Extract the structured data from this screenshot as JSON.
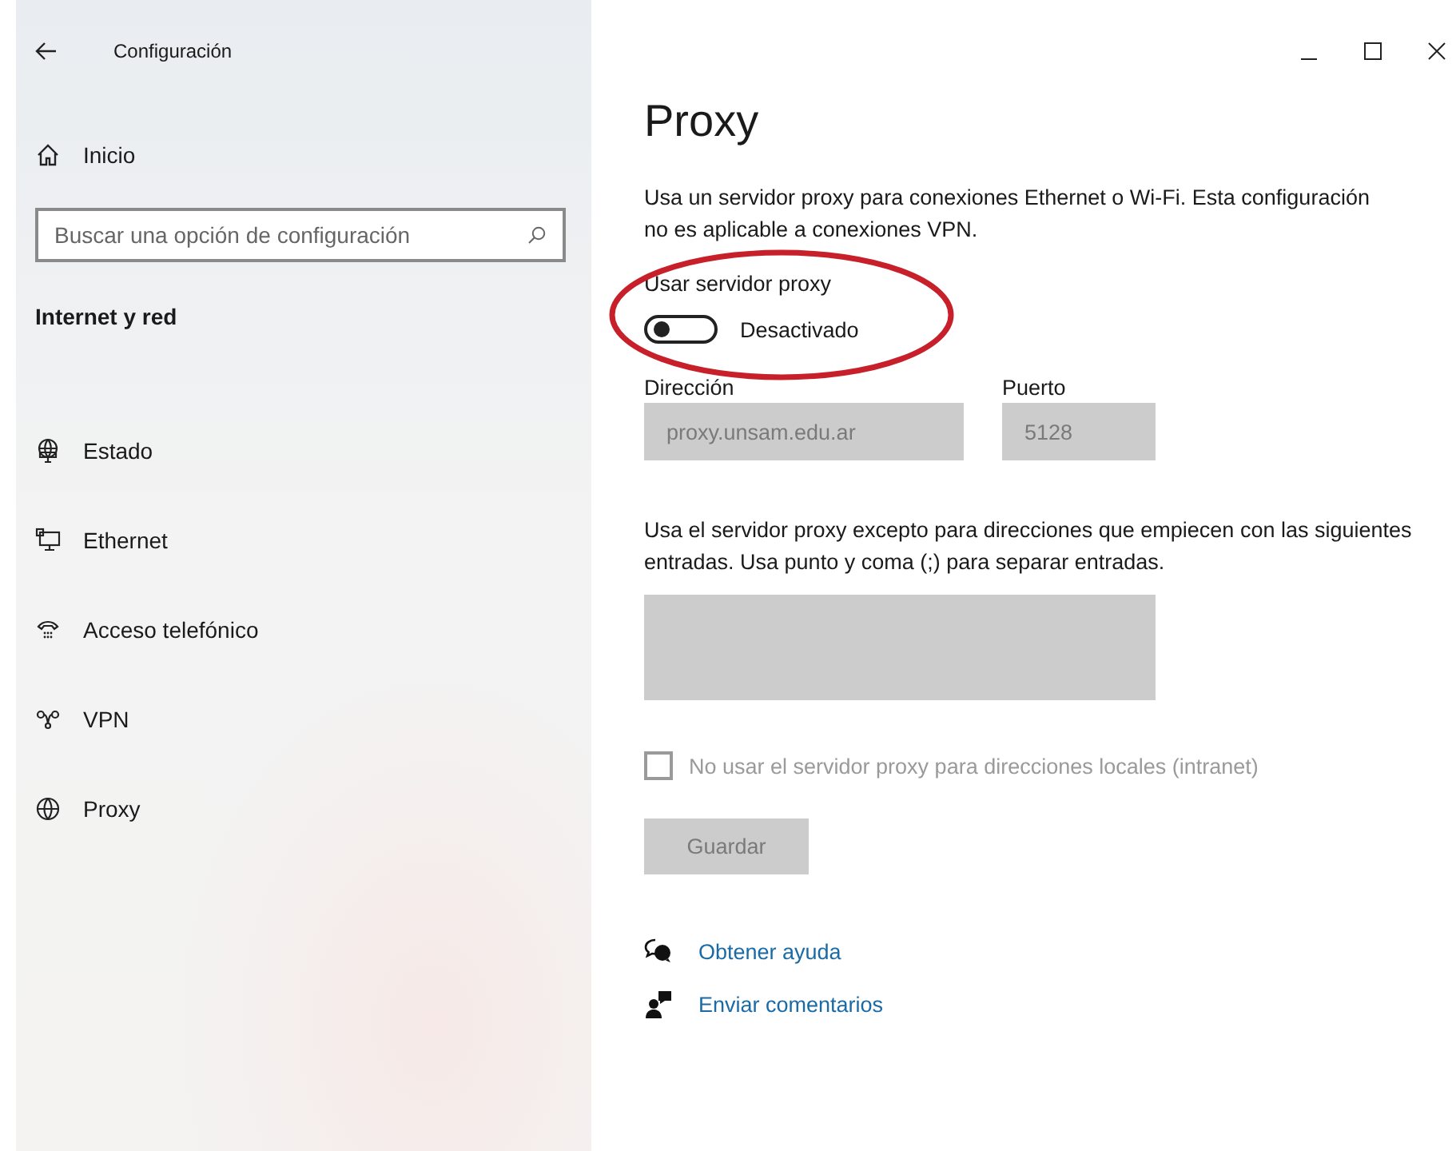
{
  "window": {
    "title": "Configuración"
  },
  "sidebar": {
    "home": {
      "label": "Inicio"
    },
    "search": {
      "placeholder": "Buscar una opción de configuración"
    },
    "heading": "Internet y red",
    "items": [
      {
        "kind": "status",
        "label": "Estado"
      },
      {
        "kind": "ethernet",
        "label": "Ethernet"
      },
      {
        "kind": "dialup",
        "label": "Acceso telefónico"
      },
      {
        "kind": "vpn",
        "label": "VPN"
      },
      {
        "kind": "proxy",
        "label": "Proxy"
      }
    ]
  },
  "content": {
    "title": "Proxy",
    "description": "Usa un servidor proxy para conexiones Ethernet o Wi-Fi. Esta configuración no es aplicable a conexiones VPN.",
    "proxy_toggle": {
      "label": "Usar servidor proxy",
      "on": false,
      "state_text": "Desactivado",
      "circled": true
    },
    "address": {
      "label": "Dirección",
      "value": "proxy.unsam.edu.ar",
      "disabled": true
    },
    "port": {
      "label": "Puerto",
      "value": "5128",
      "disabled": true
    },
    "exceptions": {
      "text": "Usa el servidor proxy excepto para direcciones que empiecen con las siguientes entradas. Usa punto y coma (;) para separar entradas.",
      "disabled": true
    },
    "local_checkbox": {
      "label": "No usar el servidor proxy para direcciones locales (intranet)",
      "checked": false,
      "disabled": true
    },
    "save_button": {
      "label": "Guardar",
      "disabled": true
    },
    "links": [
      {
        "kind": "help",
        "label": "Obtener ayuda"
      },
      {
        "kind": "feedback",
        "label": "Enviar comentarios"
      }
    ]
  }
}
